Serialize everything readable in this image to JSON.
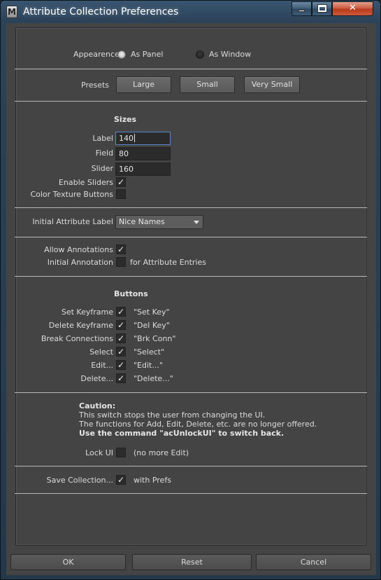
{
  "window": {
    "title": "Attribute Collection Preferences",
    "app_icon": "maya-icon"
  },
  "appearance": {
    "label": "Appearence",
    "options": [
      "As Panel",
      "As Window"
    ],
    "selected": "As Panel"
  },
  "presets": {
    "label": "Presets",
    "buttons": [
      "Large",
      "Small",
      "Very Small"
    ]
  },
  "sizes": {
    "heading": "Sizes",
    "label_label": "Label",
    "label_value": "140",
    "field_label": "Field",
    "field_value": "80",
    "slider_label": "Slider",
    "slider_value": "160",
    "enable_sliders_label": "Enable Sliders",
    "enable_sliders": true,
    "color_texture_label": "Color Texture Buttons",
    "color_texture": false
  },
  "initial_attribute": {
    "label": "Initial Attribute Label",
    "value": "Nice Names"
  },
  "annotations": {
    "allow_label": "Allow Annotations",
    "allow": true,
    "initial_label": "Initial Annotation",
    "initial": false,
    "initial_suffix": "for Attribute Entries"
  },
  "buttons_section": {
    "heading": "Buttons",
    "rows": [
      {
        "label": "Set Keyframe",
        "text": "\"Set Key\"",
        "checked": true
      },
      {
        "label": "Delete Keyframe",
        "text": "\"Del Key\"",
        "checked": true
      },
      {
        "label": "Break Connections",
        "text": "\"Brk Conn\"",
        "checked": true
      },
      {
        "label": "Select",
        "text": "\"Select\"",
        "checked": true
      },
      {
        "label": "Edit...",
        "text": "\"Edit...\"",
        "checked": true
      },
      {
        "label": "Delete...",
        "text": "\"Delete...\"",
        "checked": true
      }
    ]
  },
  "caution": {
    "title": "Caution:",
    "line1": "This switch stops the user from changing the UI.",
    "line2": "The functions for Add, Edit, Delete, etc. are no longer offered.",
    "line3": "Use the command \"acUnlockUI\" to switch back.",
    "lock_label": "Lock UI",
    "lock": false,
    "lock_suffix": "(no more Edit)"
  },
  "save": {
    "label": "Save Collection...",
    "checked": true,
    "suffix": "with Prefs"
  },
  "footer": {
    "ok": "OK",
    "reset": "Reset",
    "cancel": "Cancel"
  }
}
